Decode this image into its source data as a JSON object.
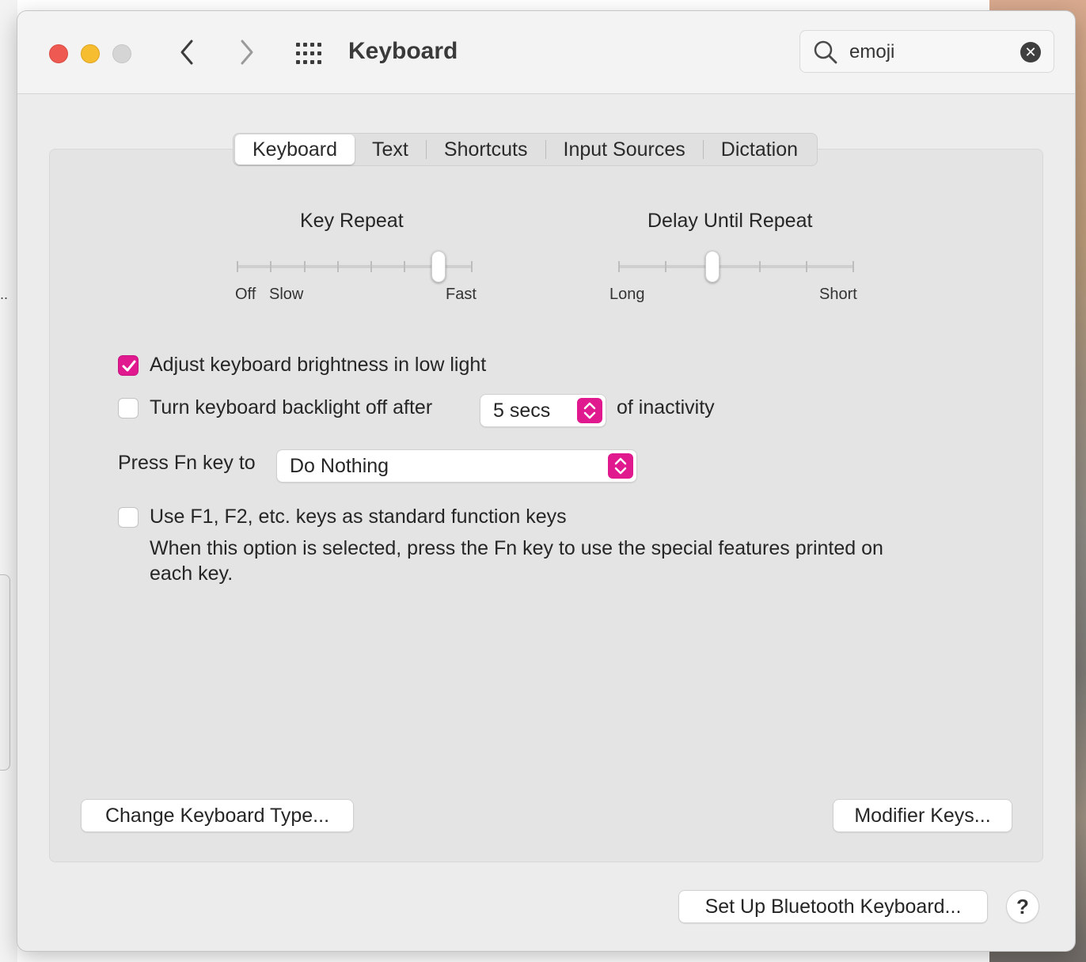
{
  "window": {
    "title": "Keyboard"
  },
  "search": {
    "value": "emoji",
    "clear_label": "✕"
  },
  "tabs": [
    {
      "label": "Keyboard",
      "active": true
    },
    {
      "label": "Text",
      "active": false
    },
    {
      "label": "Shortcuts",
      "active": false
    },
    {
      "label": "Input Sources",
      "active": false
    },
    {
      "label": "Dictation",
      "active": false
    }
  ],
  "key_repeat": {
    "title": "Key Repeat",
    "labels": {
      "off": "Off",
      "slow": "Slow",
      "fast": "Fast"
    },
    "stops": 8,
    "value_index": 6
  },
  "delay_until_repeat": {
    "title": "Delay Until Repeat",
    "labels": {
      "long": "Long",
      "short": "Short"
    },
    "stops": 6,
    "value_index": 2
  },
  "options": {
    "brightness": {
      "label": "Adjust keyboard brightness in low light",
      "checked": true
    },
    "backlight": {
      "label": "Turn keyboard backlight off after",
      "checked": false,
      "select_value": "5 secs",
      "suffix": "of inactivity"
    },
    "fn_key": {
      "label": "Press Fn key to",
      "select_value": "Do Nothing"
    },
    "function_keys": {
      "label": "Use F1, F2, etc. keys as standard function keys",
      "checked": false,
      "description_line1": "When this option is selected, press the Fn key to use the special features printed on",
      "description_line2": "each key."
    }
  },
  "buttons": {
    "change_type": "Change Keyboard Type...",
    "modifier_keys": "Modifier Keys...",
    "bluetooth": "Set Up Bluetooth Keyboard...",
    "help": "?"
  },
  "colors": {
    "accent": "#e0198f"
  }
}
